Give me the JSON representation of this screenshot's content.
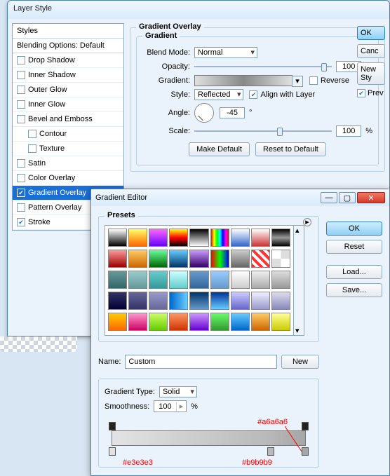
{
  "layer_style": {
    "title": "Layer Style",
    "styles_header": "Styles",
    "blending_default": "Blending Options: Default",
    "items": [
      {
        "label": "Drop Shadow",
        "checked": false
      },
      {
        "label": "Inner Shadow",
        "checked": false
      },
      {
        "label": "Outer Glow",
        "checked": false
      },
      {
        "label": "Inner Glow",
        "checked": false
      },
      {
        "label": "Bevel and Emboss",
        "checked": false
      },
      {
        "label": "Contour",
        "checked": false,
        "indent": true
      },
      {
        "label": "Texture",
        "checked": false,
        "indent": true
      },
      {
        "label": "Satin",
        "checked": false
      },
      {
        "label": "Color Overlay",
        "checked": false
      },
      {
        "label": "Gradient Overlay",
        "checked": true,
        "selected": true
      },
      {
        "label": "Pattern Overlay",
        "checked": false
      },
      {
        "label": "Stroke",
        "checked": true
      }
    ],
    "panel": {
      "title_outer": "Gradient Overlay",
      "title_inner": "Gradient",
      "blend_mode_label": "Blend Mode:",
      "blend_mode_value": "Normal",
      "opacity_label": "Opacity:",
      "opacity_value": "100",
      "opacity_unit": "%",
      "gradient_label": "Gradient:",
      "reverse_label": "Reverse",
      "style_label": "Style:",
      "style_value": "Reflected",
      "align_label": "Align with Layer",
      "angle_label": "Angle:",
      "angle_value": "-45",
      "angle_unit": "°",
      "scale_label": "Scale:",
      "scale_value": "100",
      "scale_unit": "%",
      "make_default": "Make Default",
      "reset_default": "Reset to Default"
    },
    "buttons": {
      "ok": "OK",
      "cancel": "Canc",
      "new_style": "New Sty",
      "preview": "Prev"
    }
  },
  "grad_editor": {
    "title": "Gradient Editor",
    "presets_label": "Presets",
    "name_label": "Name:",
    "name_value": "Custom",
    "new_btn": "New",
    "grad_type_label": "Gradient Type:",
    "grad_type_value": "Solid",
    "smooth_label": "Smoothness:",
    "smooth_value": "100",
    "smooth_unit": "%",
    "buttons": {
      "ok": "OK",
      "reset": "Reset",
      "load": "Load...",
      "save": "Save..."
    },
    "preset_swatches": [
      "linear-gradient(#fff,#000)",
      "linear-gradient(#ff6,#f60)",
      "linear-gradient(#f6f,#60f)",
      "linear-gradient(#ff0,#f00,#000)",
      "linear-gradient(#000,#fff)",
      "linear-gradient(90deg,#f00,#ff0,#0f0,#0ff,#00f,#f0f,#f00)",
      "linear-gradient(#fff,#36c)",
      "linear-gradient(#fff,#c33)",
      "linear-gradient(#000,#999,#000)",
      "linear-gradient(#f99,#900)",
      "linear-gradient(#fc6,#c60)",
      "linear-gradient(#6f9,#060)",
      "linear-gradient(#6cf,#036)",
      "linear-gradient(#c9f,#306)",
      "linear-gradient(90deg,#f00,#0f0,#00f)",
      "linear-gradient(#ccc,#666)",
      "repeating-linear-gradient(45deg,#f33 0 4px,#fff 4px 8px)",
      "repeating-conic-gradient(#ddd 0 25%,#fff 0 50%)",
      "linear-gradient(#699,#366)",
      "linear-gradient(#9cc,#699)",
      "linear-gradient(#6cc,#399)",
      "linear-gradient(#cff,#6cc)",
      "linear-gradient(#69c,#369)",
      "linear-gradient(#9cf,#69c)",
      "linear-gradient(#fff,#ccc)",
      "linear-gradient(#eee,#aaa)",
      "linear-gradient(#ddd,#999)",
      "linear-gradient(#336,#003)",
      "linear-gradient(#669,#336)",
      "linear-gradient(#99c,#669)",
      "linear-gradient(90deg,#06c,#6cf)",
      "linear-gradient(#036,#69c)",
      "linear-gradient(#039,#6cf)",
      "linear-gradient(#ccf,#66c)",
      "linear-gradient(#eef,#99c)",
      "linear-gradient(#dde,#88b)",
      "linear-gradient(#fc0,#f60)",
      "linear-gradient(#f9c,#c06)",
      "linear-gradient(#cf6,#6c0)",
      "linear-gradient(#f96,#c30)",
      "linear-gradient(#c9f,#60c)",
      "linear-gradient(#6f6,#393)",
      "linear-gradient(#6cf,#06c)",
      "linear-gradient(#fc6,#c60)",
      "linear-gradient(#ff9,#cc0)"
    ],
    "annotations": {
      "top_right": "#a6a6a6",
      "bot_left": "#e3e3e3",
      "bot_right": "#b9b9b9"
    }
  }
}
